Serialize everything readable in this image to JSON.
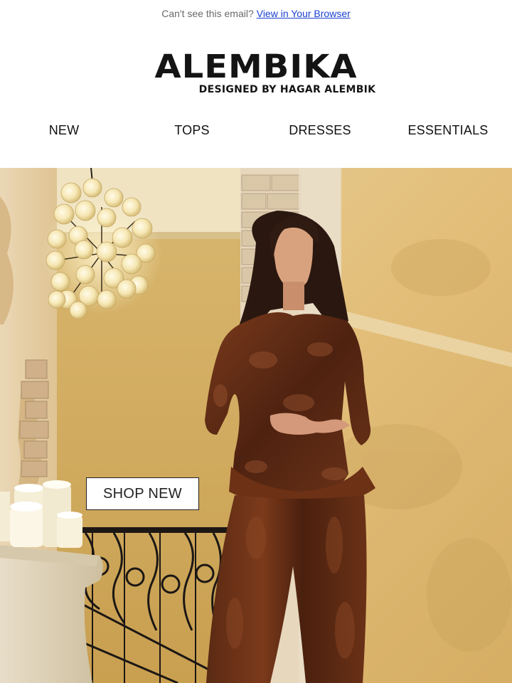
{
  "preheader": {
    "text": "Can't see this email?",
    "link_label": "View in Your Browser"
  },
  "brand": {
    "name": "ALEMBIKA",
    "tagline": "DESIGNED BY HAGAR ALEMBIK"
  },
  "nav": {
    "items": [
      {
        "label": "NEW"
      },
      {
        "label": "TOPS"
      },
      {
        "label": "DRESSES"
      },
      {
        "label": "ESSENTIALS"
      }
    ]
  },
  "hero": {
    "image_name": "model-in-brown-velvet-set",
    "cta_label": "SHOP NEW"
  },
  "colors": {
    "link": "#1a3fcf",
    "logo": "#141414",
    "velvet": "#5a2a14",
    "wall": "#e2c07e"
  }
}
